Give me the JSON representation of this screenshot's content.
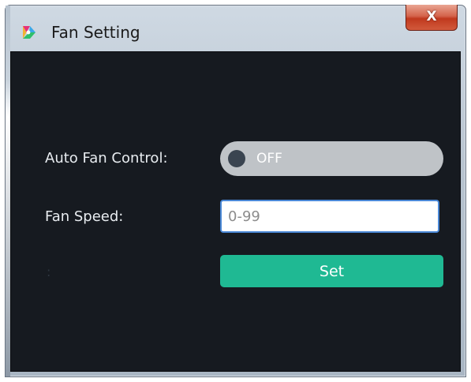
{
  "window": {
    "title": "Fan Setting",
    "close_label": "X",
    "app_icon": "app-logo-icon"
  },
  "form": {
    "auto_fan_label": "Auto Fan Control:",
    "auto_fan_state": "OFF",
    "fan_speed_label": "Fan Speed:",
    "fan_speed_value": "",
    "fan_speed_placeholder": "0-99",
    "status_text": ":",
    "set_label": "Set"
  },
  "colors": {
    "background": "#161a20",
    "toggle_off": "#bfc3c7",
    "set_button": "#1fb993",
    "input_border": "#4a88d6",
    "close_button": "#c0391e"
  }
}
